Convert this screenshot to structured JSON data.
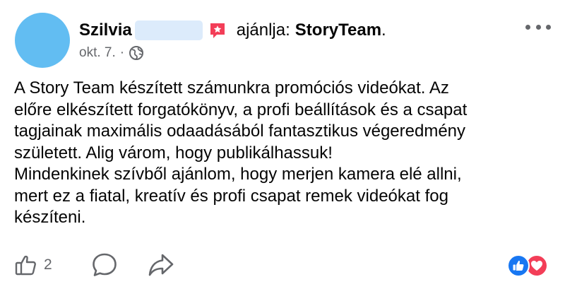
{
  "post": {
    "author_name": "Szilvia",
    "recommends_text": "ajánlja:",
    "page_name": "StoryTeam",
    "page_name_suffix": ".",
    "date": "okt. 7.",
    "meta_separator": "·",
    "audience_icon": "globe-icon",
    "recommend_icon": "recommend-star-icon",
    "text_lines": [
      "A Story Team készített számunkra promóciós videókat. Az",
      "előre elkészített forgatókönyv, a profi beállítások és a csapat",
      "tagjainak maximális odaadásából fantasztikus végeredmény",
      "született. Alig várom, hogy publikálhassuk!",
      "Mindenkinek szívből ajánlom, hogy merjen kamera elé allni,",
      "mert ez a fiatal, kreatív és profi csapat remek videókat fog",
      "készíteni."
    ]
  },
  "actions": {
    "like_icon": "thumbs-up-icon",
    "like_count": "2",
    "comment_icon": "comment-bubble-icon",
    "share_icon": "share-arrow-icon",
    "more_icon": "more-options-icon"
  },
  "reactions": [
    "like-reaction-icon",
    "love-reaction-icon"
  ],
  "colors": {
    "avatar": "#62bdf2",
    "redaction": "#dcebfb",
    "recommend_icon": "#f33e58",
    "secondary_text": "#65676b",
    "like_blue": "#1877f2",
    "love_red": "#f33e58"
  }
}
